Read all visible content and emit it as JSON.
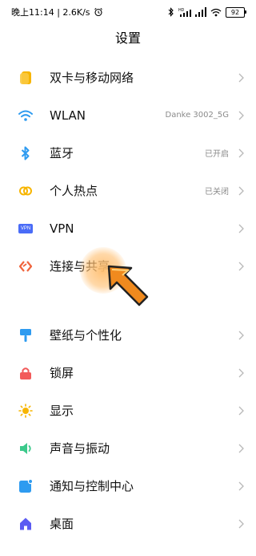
{
  "status_bar": {
    "left_text": "晚上11:14 | 2.6K/s",
    "battery": "92"
  },
  "header": {
    "title": "设置"
  },
  "group1": [
    {
      "label": "双卡与移动网络",
      "value": "",
      "icon": "sim-card-icon"
    },
    {
      "label": "WLAN",
      "value": "Danke 3002_5G",
      "icon": "wifi-icon"
    },
    {
      "label": "蓝牙",
      "value": "已开启",
      "icon": "bluetooth-icon"
    },
    {
      "label": "个人热点",
      "value": "已关闭",
      "icon": "hotspot-icon"
    },
    {
      "label": "VPN",
      "value": "",
      "icon": "vpn-icon",
      "icon_text": "VPN"
    },
    {
      "label": "连接与共享",
      "value": "",
      "icon": "connection-sharing-icon"
    }
  ],
  "group2": [
    {
      "label": "壁纸与个性化",
      "value": "",
      "icon": "wallpaper-icon"
    },
    {
      "label": "锁屏",
      "value": "",
      "icon": "lock-screen-icon"
    },
    {
      "label": "显示",
      "value": "",
      "icon": "display-sun-icon"
    },
    {
      "label": "声音与振动",
      "value": "",
      "icon": "sound-icon"
    },
    {
      "label": "通知与控制中心",
      "value": "",
      "icon": "notification-icon"
    },
    {
      "label": "桌面",
      "value": "",
      "icon": "home-icon"
    }
  ],
  "colors": {
    "sim": "#F7B500",
    "wifi": "#2E9BF0",
    "bluetooth": "#2E9BF0",
    "hotspot": "#F7B500",
    "vpn": "#4A6CF7",
    "connection": "#F0643C",
    "wallpaper": "#2E9BF0",
    "lock": "#F25A5A",
    "display": "#F7B500",
    "sound": "#3CC98B",
    "notification": "#2E9BF0",
    "home": "#5B5BF2",
    "pointer": "#F08A1E"
  }
}
